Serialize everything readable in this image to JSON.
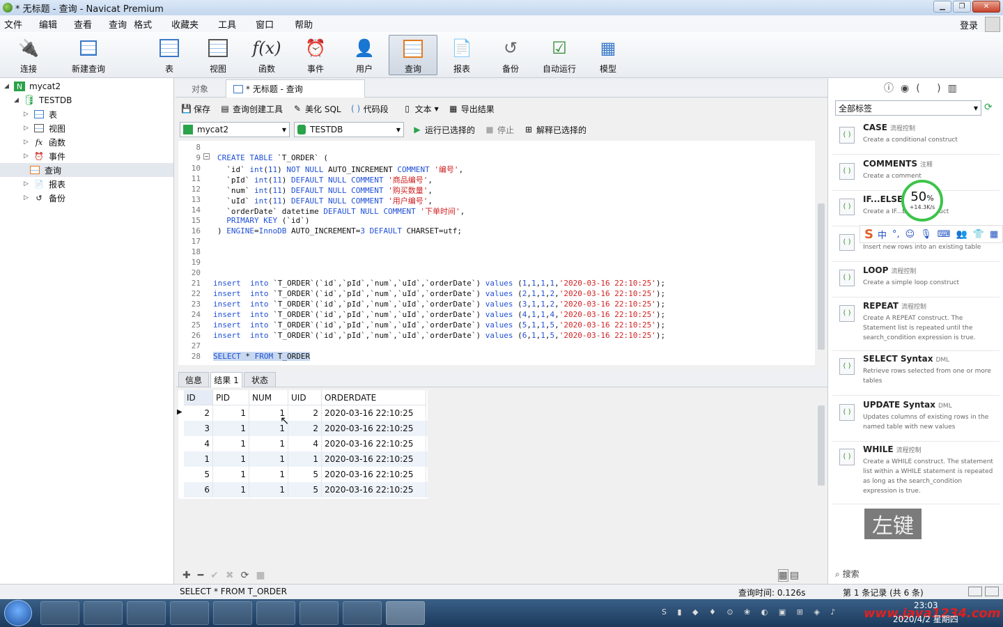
{
  "window": {
    "title": "* 无标题 - 查询 - Navicat Premium"
  },
  "menu": [
    "文件",
    "编辑",
    "查看",
    "查询",
    "格式",
    "收藏夹",
    "工具",
    "窗口",
    "帮助"
  ],
  "login": "登录",
  "toolbar": {
    "connect": "连接",
    "new_query": "新建查询",
    "table": "表",
    "view": "视图",
    "function": "函数",
    "event": "事件",
    "user": "用户",
    "query": "查询",
    "report": "报表",
    "backup": "备份",
    "autorun": "自动运行",
    "model": "模型"
  },
  "tree": {
    "conn": "mycat2",
    "db": "TESTDB",
    "items": [
      "表",
      "视图",
      "函数",
      "事件",
      "查询",
      "报表",
      "备份"
    ]
  },
  "tabs": {
    "objects": "对象",
    "query": "* 无标题 - 查询"
  },
  "qtool": {
    "save": "保存",
    "builder": "查询创建工具",
    "beautify": "美化 SQL",
    "snippet": "代码段",
    "text": "文本",
    "export": "导出结果"
  },
  "conrow": {
    "connection": "mycat2",
    "database": "TESTDB",
    "run": "运行已选择的",
    "stop": "停止",
    "explain": "解释已选择的"
  },
  "code_lines": [
    {
      "n": "8",
      "t": ""
    },
    {
      "n": "9",
      "t": "CREATE TABLE `T_ORDER` ("
    },
    {
      "n": "10",
      "t": "  `id` int(11) NOT NULL AUTO_INCREMENT COMMENT '编号',"
    },
    {
      "n": "11",
      "t": "  `pId` int(11) DEFAULT NULL COMMENT '商品编号',"
    },
    {
      "n": "12",
      "t": "  `num` int(11) DEFAULT NULL COMMENT '购买数量',"
    },
    {
      "n": "13",
      "t": "  `uId` int(11) DEFAULT NULL COMMENT '用户编号',"
    },
    {
      "n": "14",
      "t": "  `orderDate` datetime DEFAULT NULL COMMENT '下单时间',"
    },
    {
      "n": "15",
      "t": "  PRIMARY KEY (`id`)"
    },
    {
      "n": "16",
      "t": ") ENGINE=InnoDB AUTO_INCREMENT=3 DEFAULT CHARSET=utf8;"
    },
    {
      "n": "17",
      "t": ""
    },
    {
      "n": "18",
      "t": ""
    },
    {
      "n": "19",
      "t": ""
    },
    {
      "n": "20",
      "t": ""
    },
    {
      "n": "21",
      "t": "insert  into `T_ORDER`(`id`,`pId`,`num`,`uId`,`orderDate`) values (1,1,1,1,'2020-03-16 22:10:25');"
    },
    {
      "n": "22",
      "t": "insert  into `T_ORDER`(`id`,`pId`,`num`,`uId`,`orderDate`) values (2,1,1,2,'2020-03-16 22:10:25');"
    },
    {
      "n": "23",
      "t": "insert  into `T_ORDER`(`id`,`pId`,`num`,`uId`,`orderDate`) values (3,1,1,2,'2020-03-16 22:10:25');"
    },
    {
      "n": "24",
      "t": "insert  into `T_ORDER`(`id`,`pId`,`num`,`uId`,`orderDate`) values (4,1,1,4,'2020-03-16 22:10:25');"
    },
    {
      "n": "25",
      "t": "insert  into `T_ORDER`(`id`,`pId`,`num`,`uId`,`orderDate`) values (5,1,1,5,'2020-03-16 22:10:25');"
    },
    {
      "n": "26",
      "t": "insert  into `T_ORDER`(`id`,`pId`,`num`,`uId`,`orderDate`) values (6,1,1,5,'2020-03-16 22:10:25');"
    },
    {
      "n": "27",
      "t": ""
    },
    {
      "n": "28",
      "t": "SELECT * FROM T_ORDER"
    }
  ],
  "result_tabs": [
    "信息",
    "结果 1",
    "状态"
  ],
  "grid": {
    "headers": [
      "ID",
      "PID",
      "NUM",
      "UID",
      "ORDERDATE"
    ],
    "rows": [
      [
        "2",
        "1",
        "1",
        "2",
        "2020-03-16 22:10:25"
      ],
      [
        "3",
        "1",
        "1",
        "2",
        "2020-03-16 22:10:25"
      ],
      [
        "4",
        "1",
        "1",
        "4",
        "2020-03-16 22:10:25"
      ],
      [
        "1",
        "1",
        "1",
        "1",
        "2020-03-16 22:10:25"
      ],
      [
        "5",
        "1",
        "1",
        "5",
        "2020-03-16 22:10:25"
      ],
      [
        "6",
        "1",
        "1",
        "5",
        "2020-03-16 22:10:25"
      ]
    ]
  },
  "right": {
    "filter": "全部标签",
    "search": "搜索",
    "snippets": [
      {
        "title": "CASE",
        "tag": "流程控制",
        "desc": "Create a conditional construct"
      },
      {
        "title": "COMMENTS",
        "tag": "注释",
        "desc": "Create a comment"
      },
      {
        "title": "IF...ELSE...",
        "tag": "",
        "desc": "Create a IF...ELSE construct"
      },
      {
        "title": "",
        "tag": "",
        "desc": "Insert new rows into an existing table"
      },
      {
        "title": "LOOP",
        "tag": "流程控制",
        "desc": "Create a simple loop construct"
      },
      {
        "title": "REPEAT",
        "tag": "流程控制",
        "desc": "Create A REPEAT construct. The Statement list is repeated until the search_condition expression is true."
      },
      {
        "title": "SELECT Syntax",
        "tag": "DML",
        "desc": "Retrieve rows selected from one or more tables"
      },
      {
        "title": "UPDATE Syntax",
        "tag": "DML",
        "desc": "Updates columns of existing rows in the named table with new values"
      },
      {
        "title": "WHILE",
        "tag": "流程控制",
        "desc": "Create a WHILE construct. The statement list within a WHILE statement is repeated as long as the search_condition expression is true."
      }
    ]
  },
  "gauge": {
    "pct": "50",
    "unit": "%",
    "rate": "+14.3K/s"
  },
  "overlay": {
    "zuojian": "左键"
  },
  "status": {
    "sql": "SELECT * FROM T_ORDER",
    "time": "查询时间: 0.126s",
    "records": "第 1 条记录 (共 6 条)"
  },
  "clock": {
    "time": "23:03",
    "date": "2020/4/2 星期四"
  },
  "watermark": "www.java1234.com"
}
